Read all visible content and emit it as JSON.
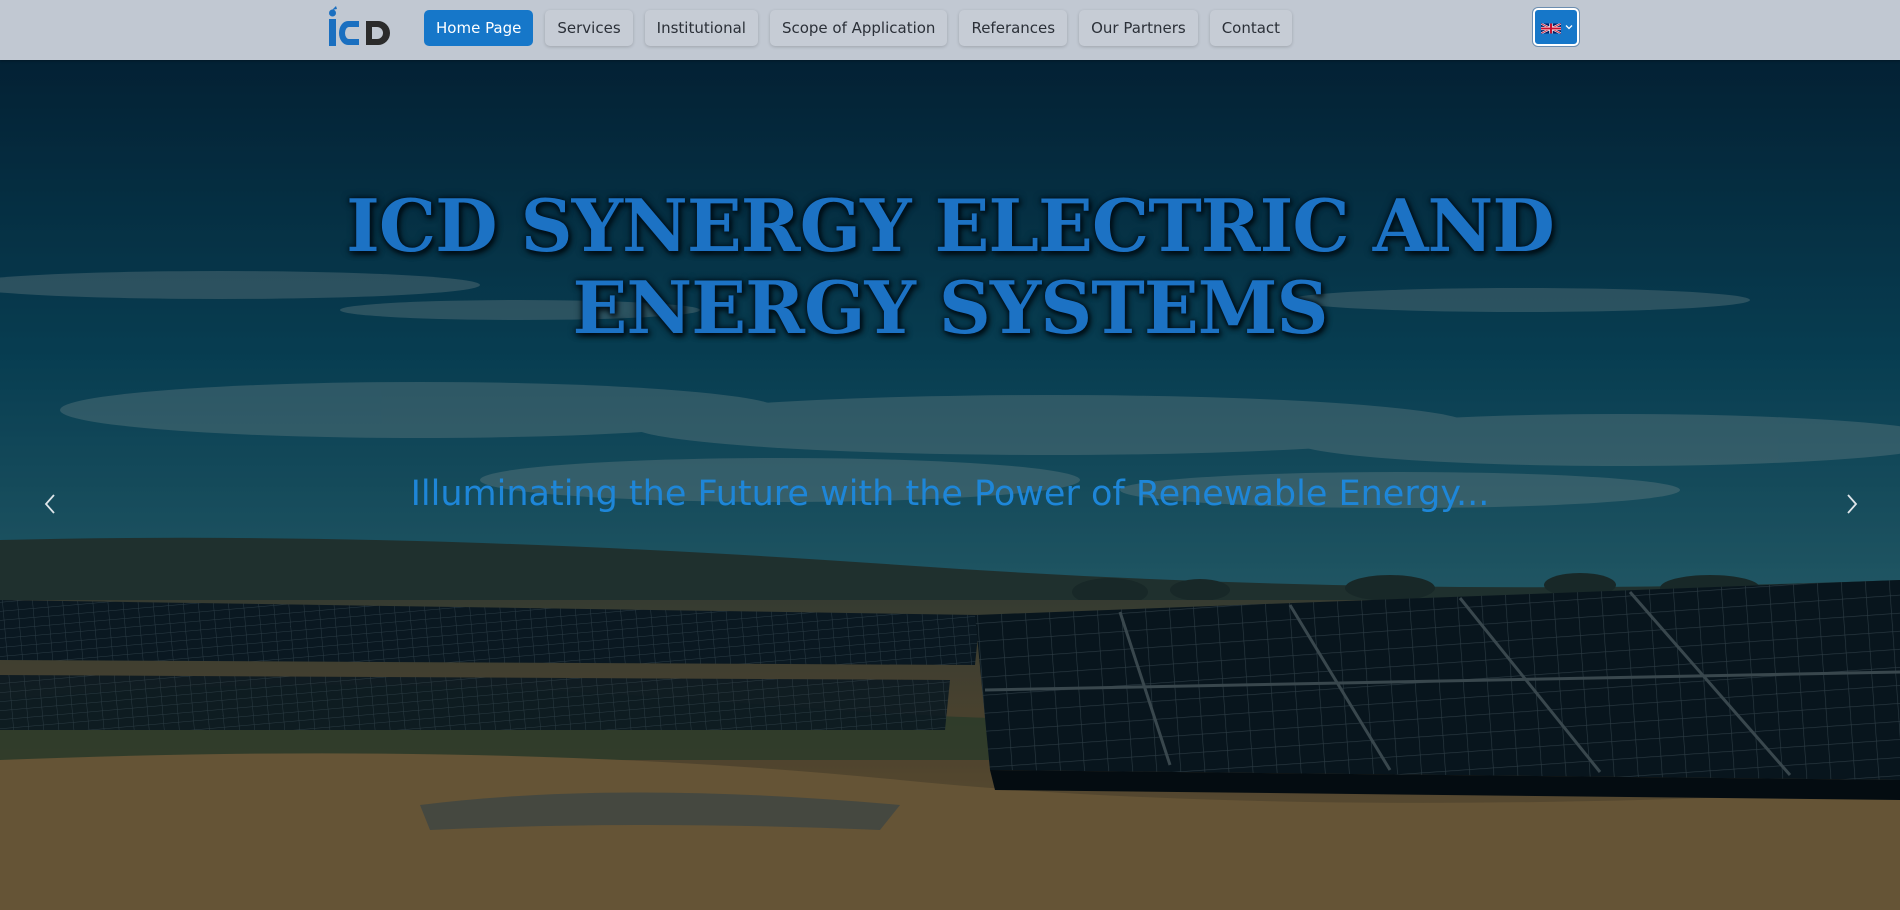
{
  "nav": {
    "logo_text": "iCD",
    "items": [
      {
        "label": "Home Page",
        "active": true
      },
      {
        "label": "Services"
      },
      {
        "label": "Institutional"
      },
      {
        "label": "Scope of Application"
      },
      {
        "label": "Referances"
      },
      {
        "label": "Our Partners"
      },
      {
        "label": "Contact"
      }
    ],
    "language": {
      "icon": "uk-flag-icon",
      "chevron": "chevron-down-icon"
    }
  },
  "hero": {
    "title": "ICD SYNERGY ELECTRIC AND ENERGY SYSTEMS",
    "subtitle": "Illuminating the Future with the Power of Renewable Energy...",
    "prev_icon": "chevron-left-icon",
    "next_icon": "chevron-right-icon"
  },
  "colors": {
    "navbar_bg": "#c1c8d2",
    "accent": "#1677c9",
    "title": "#1c72c4",
    "subtitle": "#1e86d8"
  }
}
